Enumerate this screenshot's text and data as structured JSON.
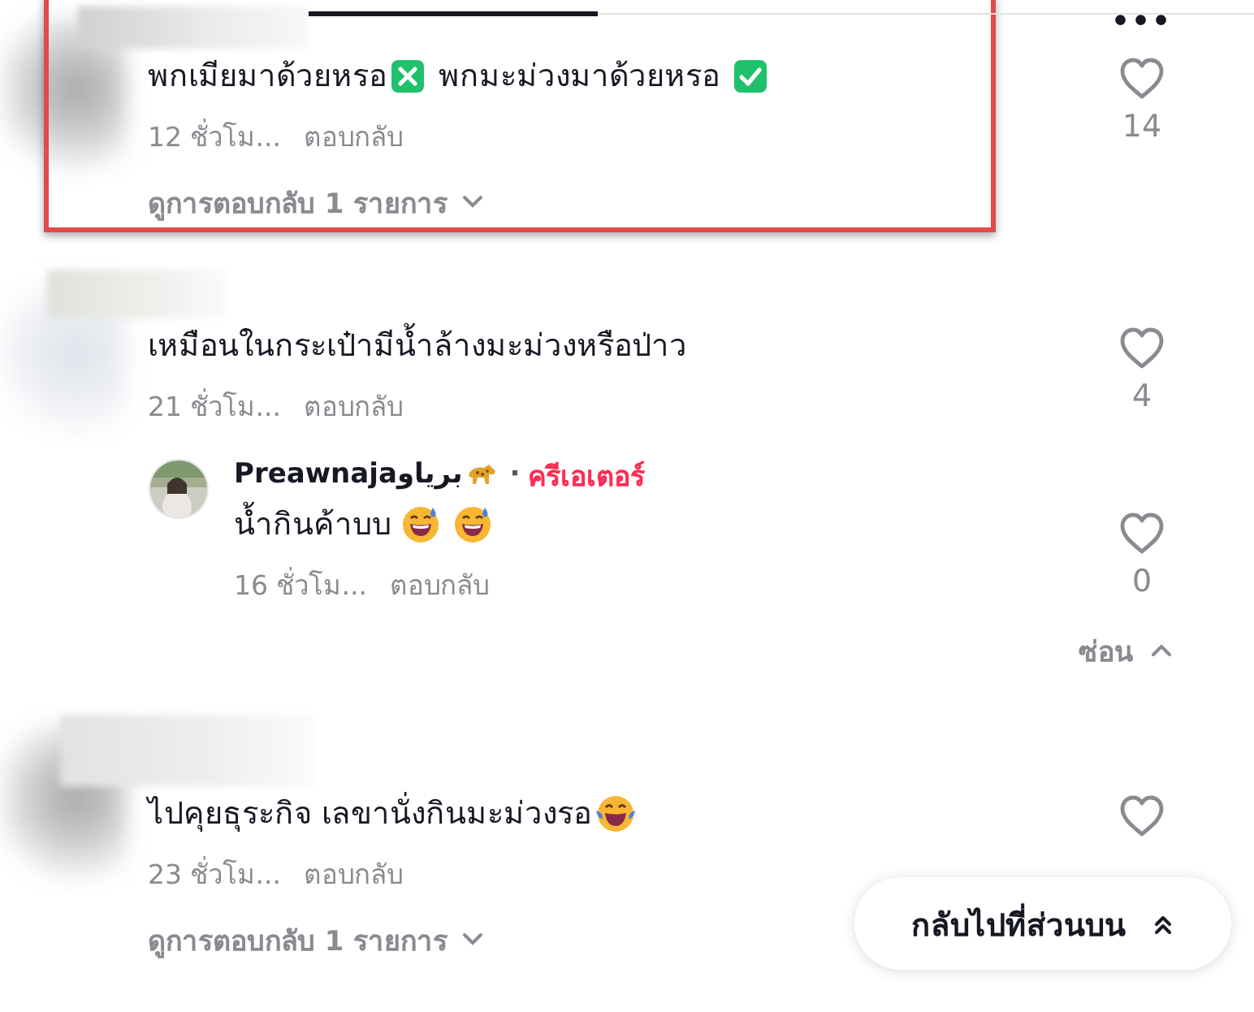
{
  "more_menu": {
    "label": "•••"
  },
  "comments": [
    {
      "highlighted": true,
      "segments": [
        {
          "kind": "text",
          "text": "พกเมียมาด้วยหรอ"
        },
        {
          "kind": "cross-box"
        },
        {
          "kind": "text",
          "text": " พกมะม่วงมาด้วยหรอ "
        },
        {
          "kind": "check-box"
        }
      ],
      "time": "12 ชั่วโม...",
      "reply": "ตอบกลับ",
      "likes": "14",
      "view_replies": "ดูการตอบกลับ 1 รายการ"
    },
    {
      "highlighted": false,
      "segments": [
        {
          "kind": "text",
          "text": "เหมือนในกระเป๋ามีน้ำล้างมะม่วงหรือป่าว"
        }
      ],
      "time": "21 ชั่วโม...",
      "reply": "ตอบกลับ",
      "likes": "4",
      "replies": [
        {
          "author": "Preawnajaبرياو",
          "separator": "·",
          "badge": "ครีเอเตอร์",
          "segments": [
            {
              "kind": "text",
              "text": "น้ำกินค้าบบ "
            },
            {
              "kind": "sweat-smile"
            },
            {
              "kind": "sweat-smile"
            }
          ],
          "time": "16 ชั่วโม...",
          "reply": "ตอบกลับ",
          "likes": "0"
        }
      ],
      "hide_replies": "ซ่อน"
    },
    {
      "highlighted": false,
      "segments": [
        {
          "kind": "text",
          "text": "ไปคุยธุระกิจ เลขานั่งกินมะม่วงรอ"
        },
        {
          "kind": "tears-joy"
        }
      ],
      "time": "23 ชั่วโม...",
      "reply": "ตอบกลับ",
      "view_replies": "ดูการตอบกลับ 1 รายการ"
    }
  ],
  "back_to_top": {
    "label": "กลับไปที่ส่วนบน"
  }
}
